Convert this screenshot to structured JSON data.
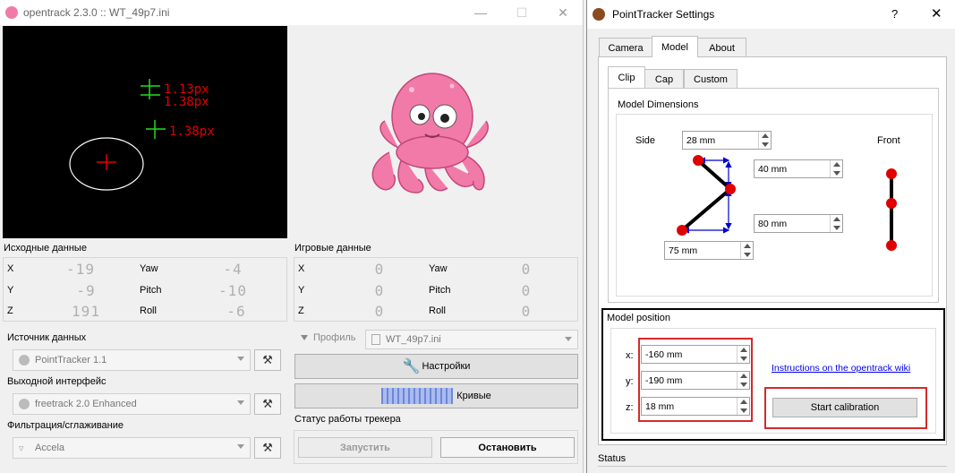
{
  "main_window": {
    "title": "opentrack 2.3.0 :: WT_49p7.ini",
    "tracker_preview": {
      "points": [
        "1.13px",
        "1.38px",
        "1.38px"
      ]
    },
    "raw_data": {
      "label": "Исходные данные",
      "rows": [
        {
          "axis": "X",
          "value": "-19",
          "rot": "Yaw",
          "rot_value": "-4"
        },
        {
          "axis": "Y",
          "value": "-9",
          "rot": "Pitch",
          "rot_value": "-10"
        },
        {
          "axis": "Z",
          "value": "191",
          "rot": "Roll",
          "rot_value": "-6"
        }
      ]
    },
    "game_data": {
      "label": "Игровые данные",
      "rows": [
        {
          "axis": "X",
          "value": "0",
          "rot": "Yaw",
          "rot_value": "0"
        },
        {
          "axis": "Y",
          "value": "0",
          "rot": "Pitch",
          "rot_value": "0"
        },
        {
          "axis": "Z",
          "value": "0",
          "rot": "Roll",
          "rot_value": "0"
        }
      ]
    },
    "source": {
      "label": "Источник данных",
      "value": "PointTracker 1.1"
    },
    "output": {
      "label": "Выходной интерфейс",
      "value": "freetrack 2.0 Enhanced"
    },
    "filter": {
      "label": "Фильтрация/сглаживание",
      "value": "Accela"
    },
    "profile": {
      "label": "Профиль",
      "value": "WT_49p7.ini"
    },
    "settings_button": "Настройки",
    "curves_button": "Кривые",
    "status_label": "Статус работы трекера",
    "start_button": "Запустить",
    "stop_button": "Остановить"
  },
  "dialog": {
    "title": "PointTracker Settings",
    "help_glyph": "?",
    "tabs": [
      "Camera",
      "Model",
      "About"
    ],
    "active_tab": "Model",
    "subtabs": [
      "Clip",
      "Cap",
      "Custom"
    ],
    "active_subtab": "Clip",
    "model_dimensions": {
      "label": "Model Dimensions",
      "side_label": "Side",
      "front_label": "Front",
      "side_value": "28 mm",
      "top_value": "40 mm",
      "bottom_value": "80 mm",
      "depth_value": "75 mm"
    },
    "model_position": {
      "label": "Model position",
      "x_label": "x:",
      "x_value": "-160 mm",
      "y_label": "y:",
      "y_value": "-190 mm",
      "z_label": "z:",
      "z_value": "18 mm",
      "wiki_link": "Instructions on the opentrack wiki",
      "calibrate_button": "Start calibration"
    },
    "status_label": "Status"
  },
  "colors": {
    "highlight_red": "#d42a2a",
    "point_red": "#e00000",
    "arrow_blue": "#0000cc",
    "tracker_green": "#22dd22",
    "octopus_pink": "#f27aa9"
  }
}
